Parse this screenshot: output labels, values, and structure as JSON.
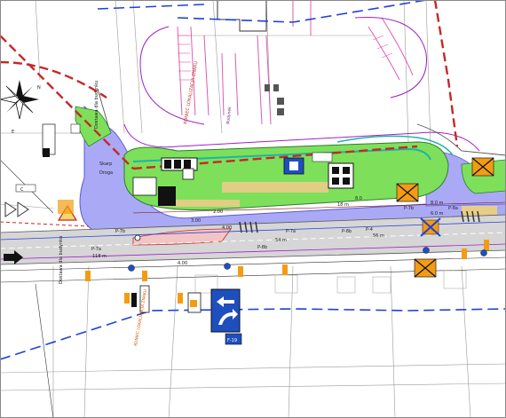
{
  "colors": {
    "background": "#ffffff",
    "grass": "#7ee05a",
    "road_fill": "#a9a9f5",
    "carriageway": "#c9c9c9",
    "boundary_red": "#c62828",
    "blue_dash": "#1e40d8",
    "purple_line": "#a020c8",
    "pink_parking": "#e05ab0",
    "cyan_curb": "#20b2aa",
    "orange_sign": "#f39c12",
    "sign_blue": "#1e4fbf"
  },
  "compass": {
    "north_label": "N",
    "east_label": "E"
  },
  "stop_labels": [
    "P-7a",
    "P-7b",
    "P-7a",
    "P-4",
    "P-8b",
    "P-8b",
    "P-8a",
    "P-7b"
  ],
  "measurements": [
    "4.00",
    "54 m",
    "4.00",
    "56 m",
    "8.0 m",
    "6.0 m",
    "3.00",
    "18 m",
    "118 m",
    "8.0",
    "2.00"
  ],
  "street_labels": [
    "Droga",
    "Skarp"
  ],
  "sign_code": "F-19",
  "vertical_notes": [
    "KONIEC LOKALIZACJA ZNAKU",
    "KONIEC LOKALIZACJA ZNAKU",
    "Dostawa dla budynku",
    "Dostawa dla budynku"
  ],
  "building_label": "Budynek",
  "small_marker": "C"
}
